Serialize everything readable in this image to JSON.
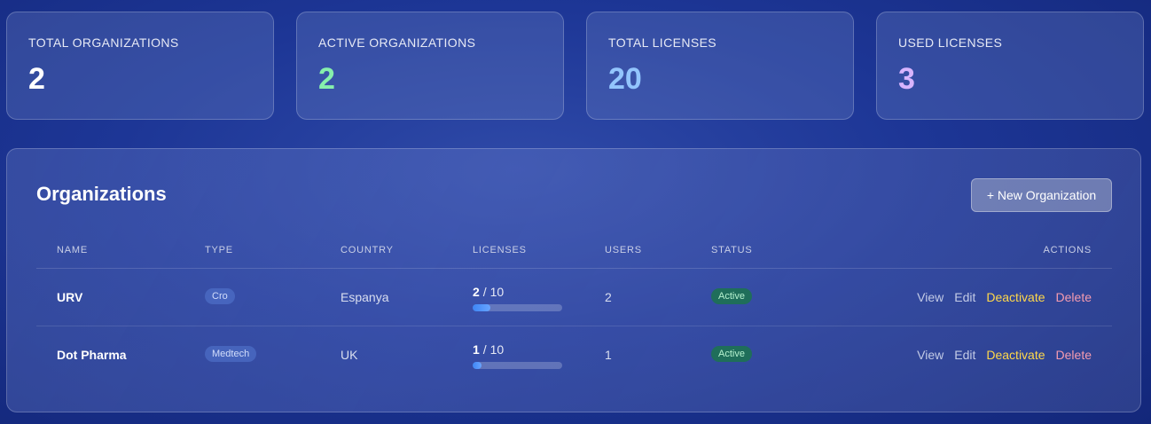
{
  "stats": [
    {
      "label": "TOTAL ORGANIZATIONS",
      "value": "2",
      "color": "#ffffff"
    },
    {
      "label": "ACTIVE ORGANIZATIONS",
      "value": "2",
      "color": "#86efac"
    },
    {
      "label": "TOTAL LICENSES",
      "value": "20",
      "color": "#93c5fd"
    },
    {
      "label": "USED LICENSES",
      "value": "3",
      "color": "#d8b4fe"
    }
  ],
  "orgs": {
    "title": "Organizations",
    "new_button": "+ New Organization",
    "columns": {
      "name": "NAME",
      "type": "TYPE",
      "country": "COUNTRY",
      "licenses": "LICENSES",
      "users": "USERS",
      "status": "STATUS",
      "actions": "ACTIONS"
    },
    "rows": [
      {
        "name": "URV",
        "type": "Cro",
        "country": "Espanya",
        "licenses_used": "2",
        "licenses_total": "/ 10",
        "license_fraction": 0.2,
        "users": "2",
        "status": "Active",
        "actions": {
          "view": "View",
          "edit": "Edit",
          "deactivate": "Deactivate",
          "delete": "Delete"
        }
      },
      {
        "name": "Dot Pharma",
        "type": "Medtech",
        "country": "UK",
        "licenses_used": "1",
        "licenses_total": "/ 10",
        "license_fraction": 0.1,
        "users": "1",
        "status": "Active",
        "actions": {
          "view": "View",
          "edit": "Edit",
          "deactivate": "Deactivate",
          "delete": "Delete"
        }
      }
    ]
  }
}
